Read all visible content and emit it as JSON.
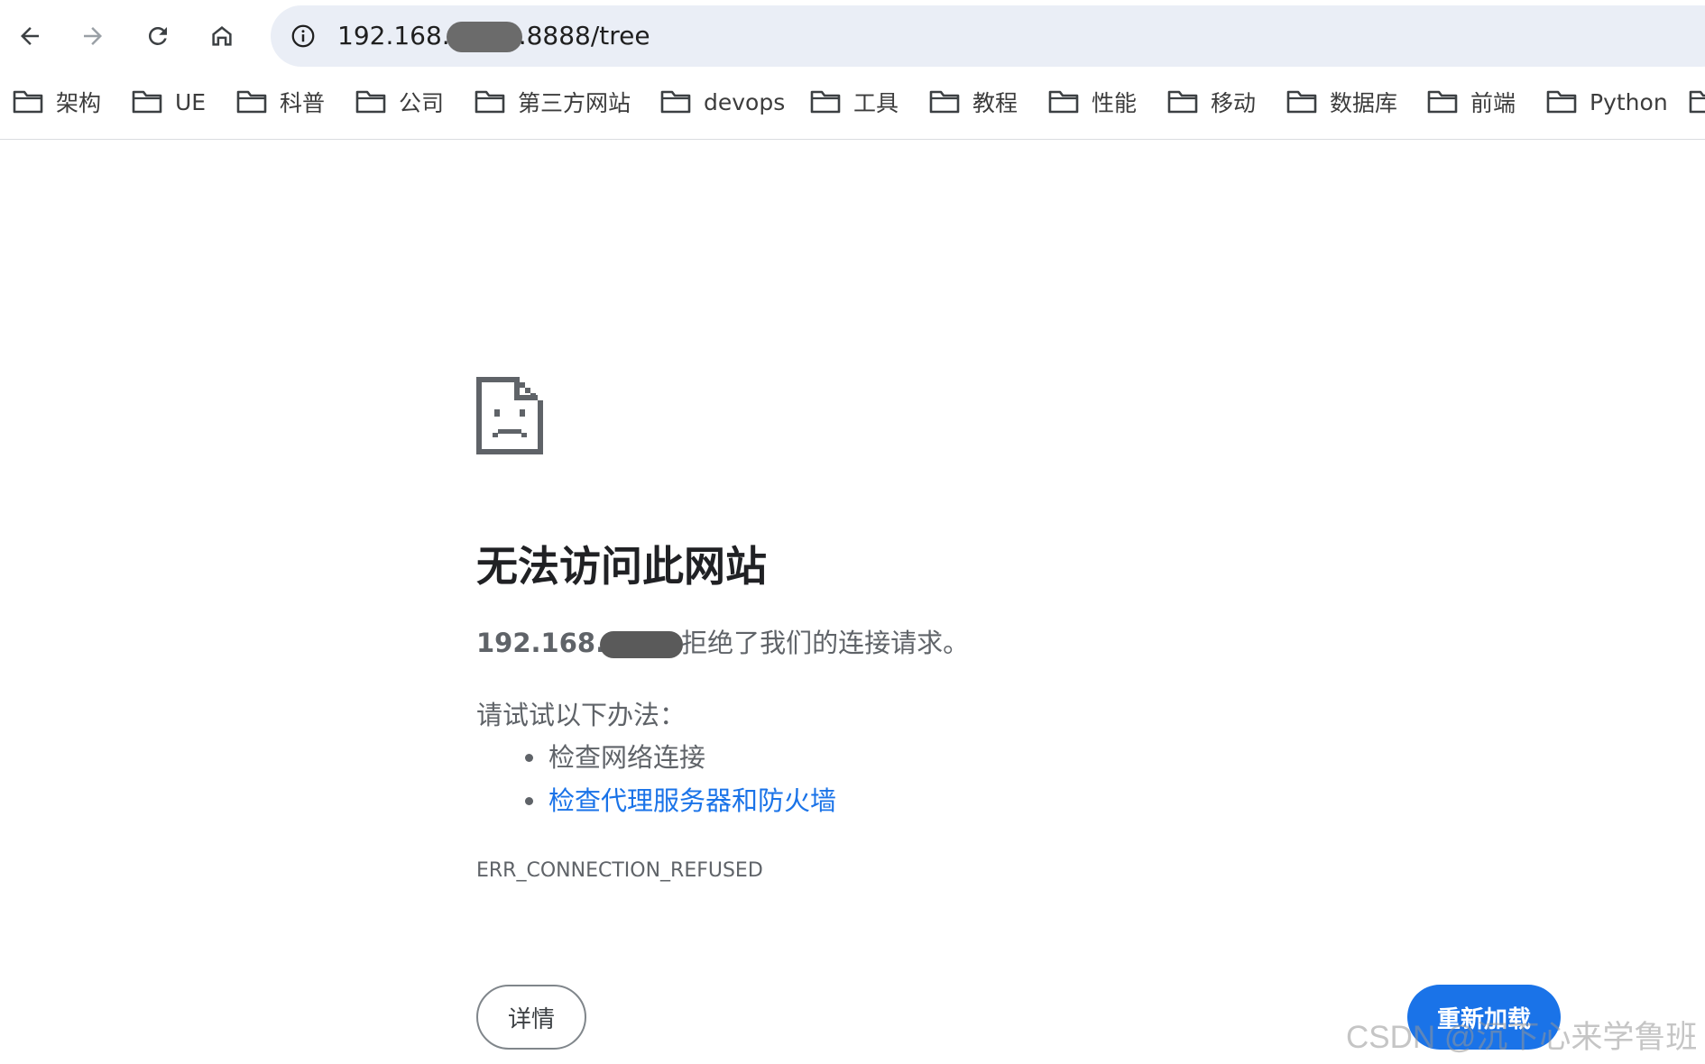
{
  "browser": {
    "icons": {
      "back": "arrow-left-icon",
      "forward": "arrow-right-icon",
      "reload": "reload-icon",
      "home": "home-icon",
      "site_info": "info-icon",
      "folder": "folder-icon"
    },
    "url": {
      "prefix": "192.168.",
      "suffix": ".8888/tree"
    }
  },
  "bookmarks": [
    {
      "label": "架构"
    },
    {
      "label": "UE"
    },
    {
      "label": "科普"
    },
    {
      "label": "公司"
    },
    {
      "label": "第三方网站"
    },
    {
      "label": "devops"
    },
    {
      "label": "工具"
    },
    {
      "label": "教程"
    },
    {
      "label": "性能"
    },
    {
      "label": "移动"
    },
    {
      "label": "数据库"
    },
    {
      "label": "前端"
    },
    {
      "label": "Python"
    }
  ],
  "error": {
    "title": "无法访问此网站",
    "host_prefix": "192.168.",
    "message": "拒绝了我们的连接请求。",
    "suggestions_title": "请试试以下办法：",
    "suggestions": [
      {
        "text": "检查网络连接",
        "link": false
      },
      {
        "text": "检查代理服务器和防火墙",
        "link": true
      }
    ],
    "code": "ERR_CONNECTION_REFUSED",
    "details_label": "详情",
    "reload_label": "重新加载"
  },
  "watermark": "CSDN @沉下心来学鲁班",
  "colors": {
    "link": "#1a73e8",
    "primary_button": "#1a73e8",
    "omnibox_bg": "#eaeef6",
    "text_secondary": "#5f6368"
  }
}
